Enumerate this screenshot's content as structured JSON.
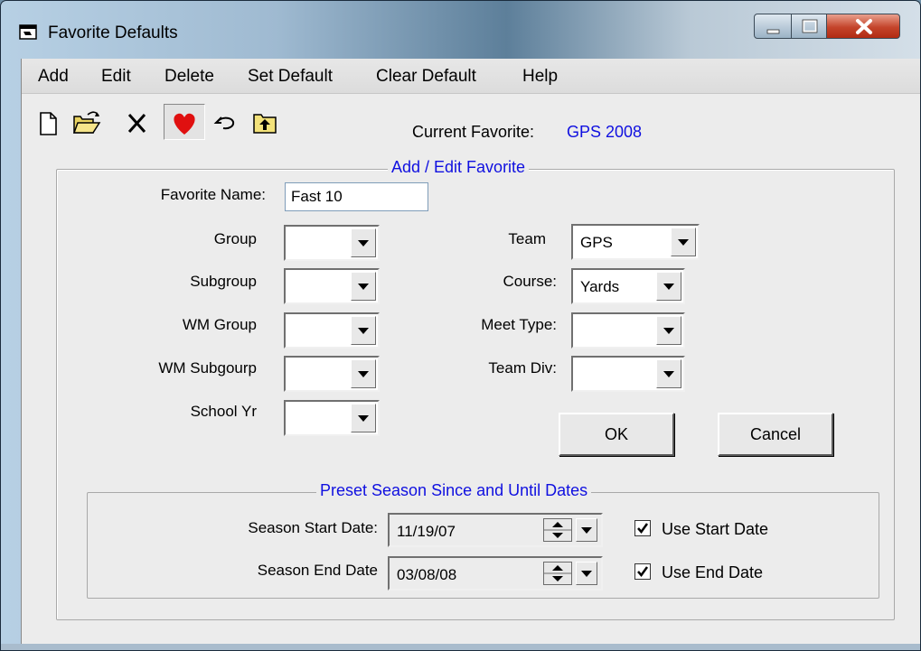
{
  "window": {
    "title": "Favorite Defaults"
  },
  "menu": [
    "Add",
    "Edit",
    "Delete",
    "Set Default",
    "Clear Default",
    "Help"
  ],
  "toolbar": {
    "icons": [
      "new-icon",
      "open-icon",
      "delete-icon",
      "favorite-heart-icon",
      "undo-icon",
      "up-folder-icon"
    ],
    "current_favorite_label": "Current Favorite:",
    "current_favorite_value": "GPS 2008"
  },
  "add_edit": {
    "legend": "Add / Edit Favorite",
    "favorite_name_label": "Favorite Name:",
    "favorite_name_value": "Fast 10",
    "left_fields": [
      {
        "label": "Group",
        "value": ""
      },
      {
        "label": "Subgroup",
        "value": ""
      },
      {
        "label": "WM Group",
        "value": ""
      },
      {
        "label": "WM Subgourp",
        "value": ""
      },
      {
        "label": "School Yr",
        "value": ""
      }
    ],
    "right_fields": [
      {
        "label": "Team",
        "value": "GPS"
      },
      {
        "label": "Course:",
        "value": "Yards"
      },
      {
        "label": "Meet Type:",
        "value": ""
      },
      {
        "label": "Team Div:",
        "value": ""
      }
    ],
    "ok_label": "OK",
    "cancel_label": "Cancel"
  },
  "season": {
    "legend": "Preset Season Since and Until Dates",
    "start_label": "Season Start Date:",
    "start_value": "11/19/07",
    "end_label": "Season End Date",
    "end_value": "03/08/08",
    "use_start_label": "Use Start Date",
    "use_start_checked": true,
    "use_end_label": "Use End Date",
    "use_end_checked": true
  },
  "colors": {
    "accent_text": "#1010e0",
    "heart": "#e01010"
  }
}
